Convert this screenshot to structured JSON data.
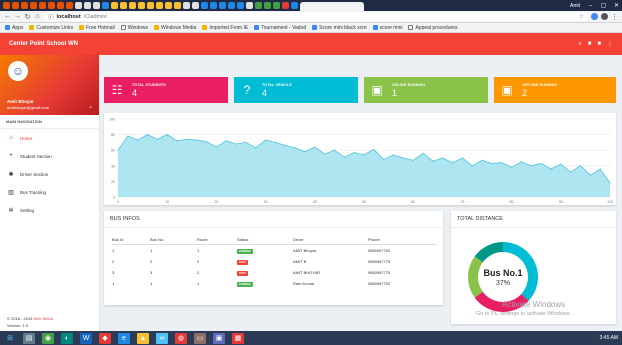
{
  "browser": {
    "user": "Amit",
    "url_host": "localhost",
    "url_path": "/Cladmin/",
    "bookmarks": [
      "Apps",
      "Customize Links",
      "Free Hotmail",
      "Windows",
      "Windows Media",
      "Imported From IE",
      "Tournament - Vadod",
      "Score mini black scre",
      "score mini",
      "Appeal procedures"
    ]
  },
  "app": {
    "title": "Center Point School WN"
  },
  "sidebar": {
    "user_name": "Amit Bhoyar",
    "user_email": "amitbhoyar@gmail.com",
    "nav_header": "MAIN NAVIGATION",
    "items": [
      {
        "label": "Home",
        "icon": "home-icon"
      },
      {
        "label": "Student Section",
        "icon": "plus-icon"
      },
      {
        "label": "Driver Section",
        "icon": "driver-icon"
      },
      {
        "label": "Bus Tracking",
        "icon": "map-icon"
      },
      {
        "label": "Setting",
        "icon": "gear-icon"
      }
    ],
    "copyright_prefix": "© 2018 - 2019",
    "copyright_brand": "NIKI INDIA",
    "version": "Version: 1.0"
  },
  "info_boxes": [
    {
      "label": "TOTAL STUDENTS",
      "value": "4",
      "color": "#e91e63",
      "icon": "users-icon"
    },
    {
      "label": "TOTAL VEHICLE",
      "value": "4",
      "color": "#00bcd4",
      "icon": "help-icon"
    },
    {
      "label": "ONLINE RUNNING",
      "value": "1",
      "color": "#8bc34a",
      "icon": "bus-icon"
    },
    {
      "label": "OFFLINE RUNNING",
      "value": "2",
      "color": "#ff9800",
      "icon": "bus-icon"
    }
  ],
  "chart_data": {
    "type": "area",
    "x": [
      0,
      2,
      4,
      6,
      8,
      10,
      12,
      14,
      16,
      18,
      20,
      22,
      24,
      26,
      28,
      30,
      32,
      34,
      36,
      38,
      40,
      42,
      44,
      46,
      48,
      50,
      52,
      54,
      56,
      58,
      60,
      62,
      64,
      66,
      68,
      70,
      72,
      74,
      76,
      78,
      80,
      82,
      84,
      86,
      88,
      90,
      92,
      94,
      96,
      98,
      100
    ],
    "y": [
      60,
      78,
      73,
      80,
      74,
      80,
      72,
      74,
      73,
      71,
      64,
      72,
      68,
      70,
      63,
      73,
      70,
      66,
      63,
      58,
      64,
      55,
      60,
      51,
      57,
      54,
      61,
      48,
      54,
      50,
      47,
      56,
      46,
      50,
      44,
      50,
      40,
      47,
      43,
      44,
      38,
      45,
      40,
      43,
      36,
      42,
      32,
      40,
      28,
      36,
      18
    ],
    "xticks": [
      0,
      10,
      20,
      30,
      40,
      50,
      60,
      70,
      80,
      90,
      100
    ],
    "yticks": [
      0,
      20,
      40,
      60,
      80,
      100
    ],
    "ylim": [
      0,
      100
    ],
    "xlim": [
      0,
      100
    ],
    "color": "#9fe0ee",
    "stroke": "#4ec4dc"
  },
  "bus_info": {
    "title": "BUS INFOS",
    "headers": [
      "Bus Id",
      "Bus No.",
      "Route",
      "Status",
      "Driver",
      "Phone"
    ],
    "rows": [
      {
        "id": "1",
        "no": "1",
        "route": "1",
        "status": "RUNNING",
        "status_color": "#4caf50",
        "driver": "AMIT Bhoyar",
        "phone": "9860967702"
      },
      {
        "id": "2",
        "no": "2",
        "route": "2",
        "status": "STOP",
        "status_color": "#f44336",
        "driver": "AMIT B",
        "phone": "9860967775"
      },
      {
        "id": "3",
        "no": "3",
        "route": "2",
        "status": "STOP",
        "status_color": "#f44336",
        "driver": "AMIT BHOYAR",
        "phone": "9860967775"
      },
      {
        "id": "1",
        "no": "1",
        "route": "1",
        "status": "RUNNING",
        "status_color": "#4caf50",
        "driver": "Ram Kumar",
        "phone": "9860967702"
      }
    ]
  },
  "total_distance": {
    "title": "TOTAL DISTANCE",
    "center_title": "Bus No.1",
    "center_value": "37%",
    "segments": [
      {
        "value": 37,
        "color": "#00bcd4"
      },
      {
        "value": 28,
        "color": "#e91e63"
      },
      {
        "value": 20,
        "color": "#8bc34a"
      },
      {
        "value": 15,
        "color": "#009688"
      }
    ]
  },
  "watermark": {
    "line1": "Activate Windows",
    "line2": "Go to PC settings to activate Windows."
  },
  "taskbar": {
    "time": "3:45 AM"
  }
}
